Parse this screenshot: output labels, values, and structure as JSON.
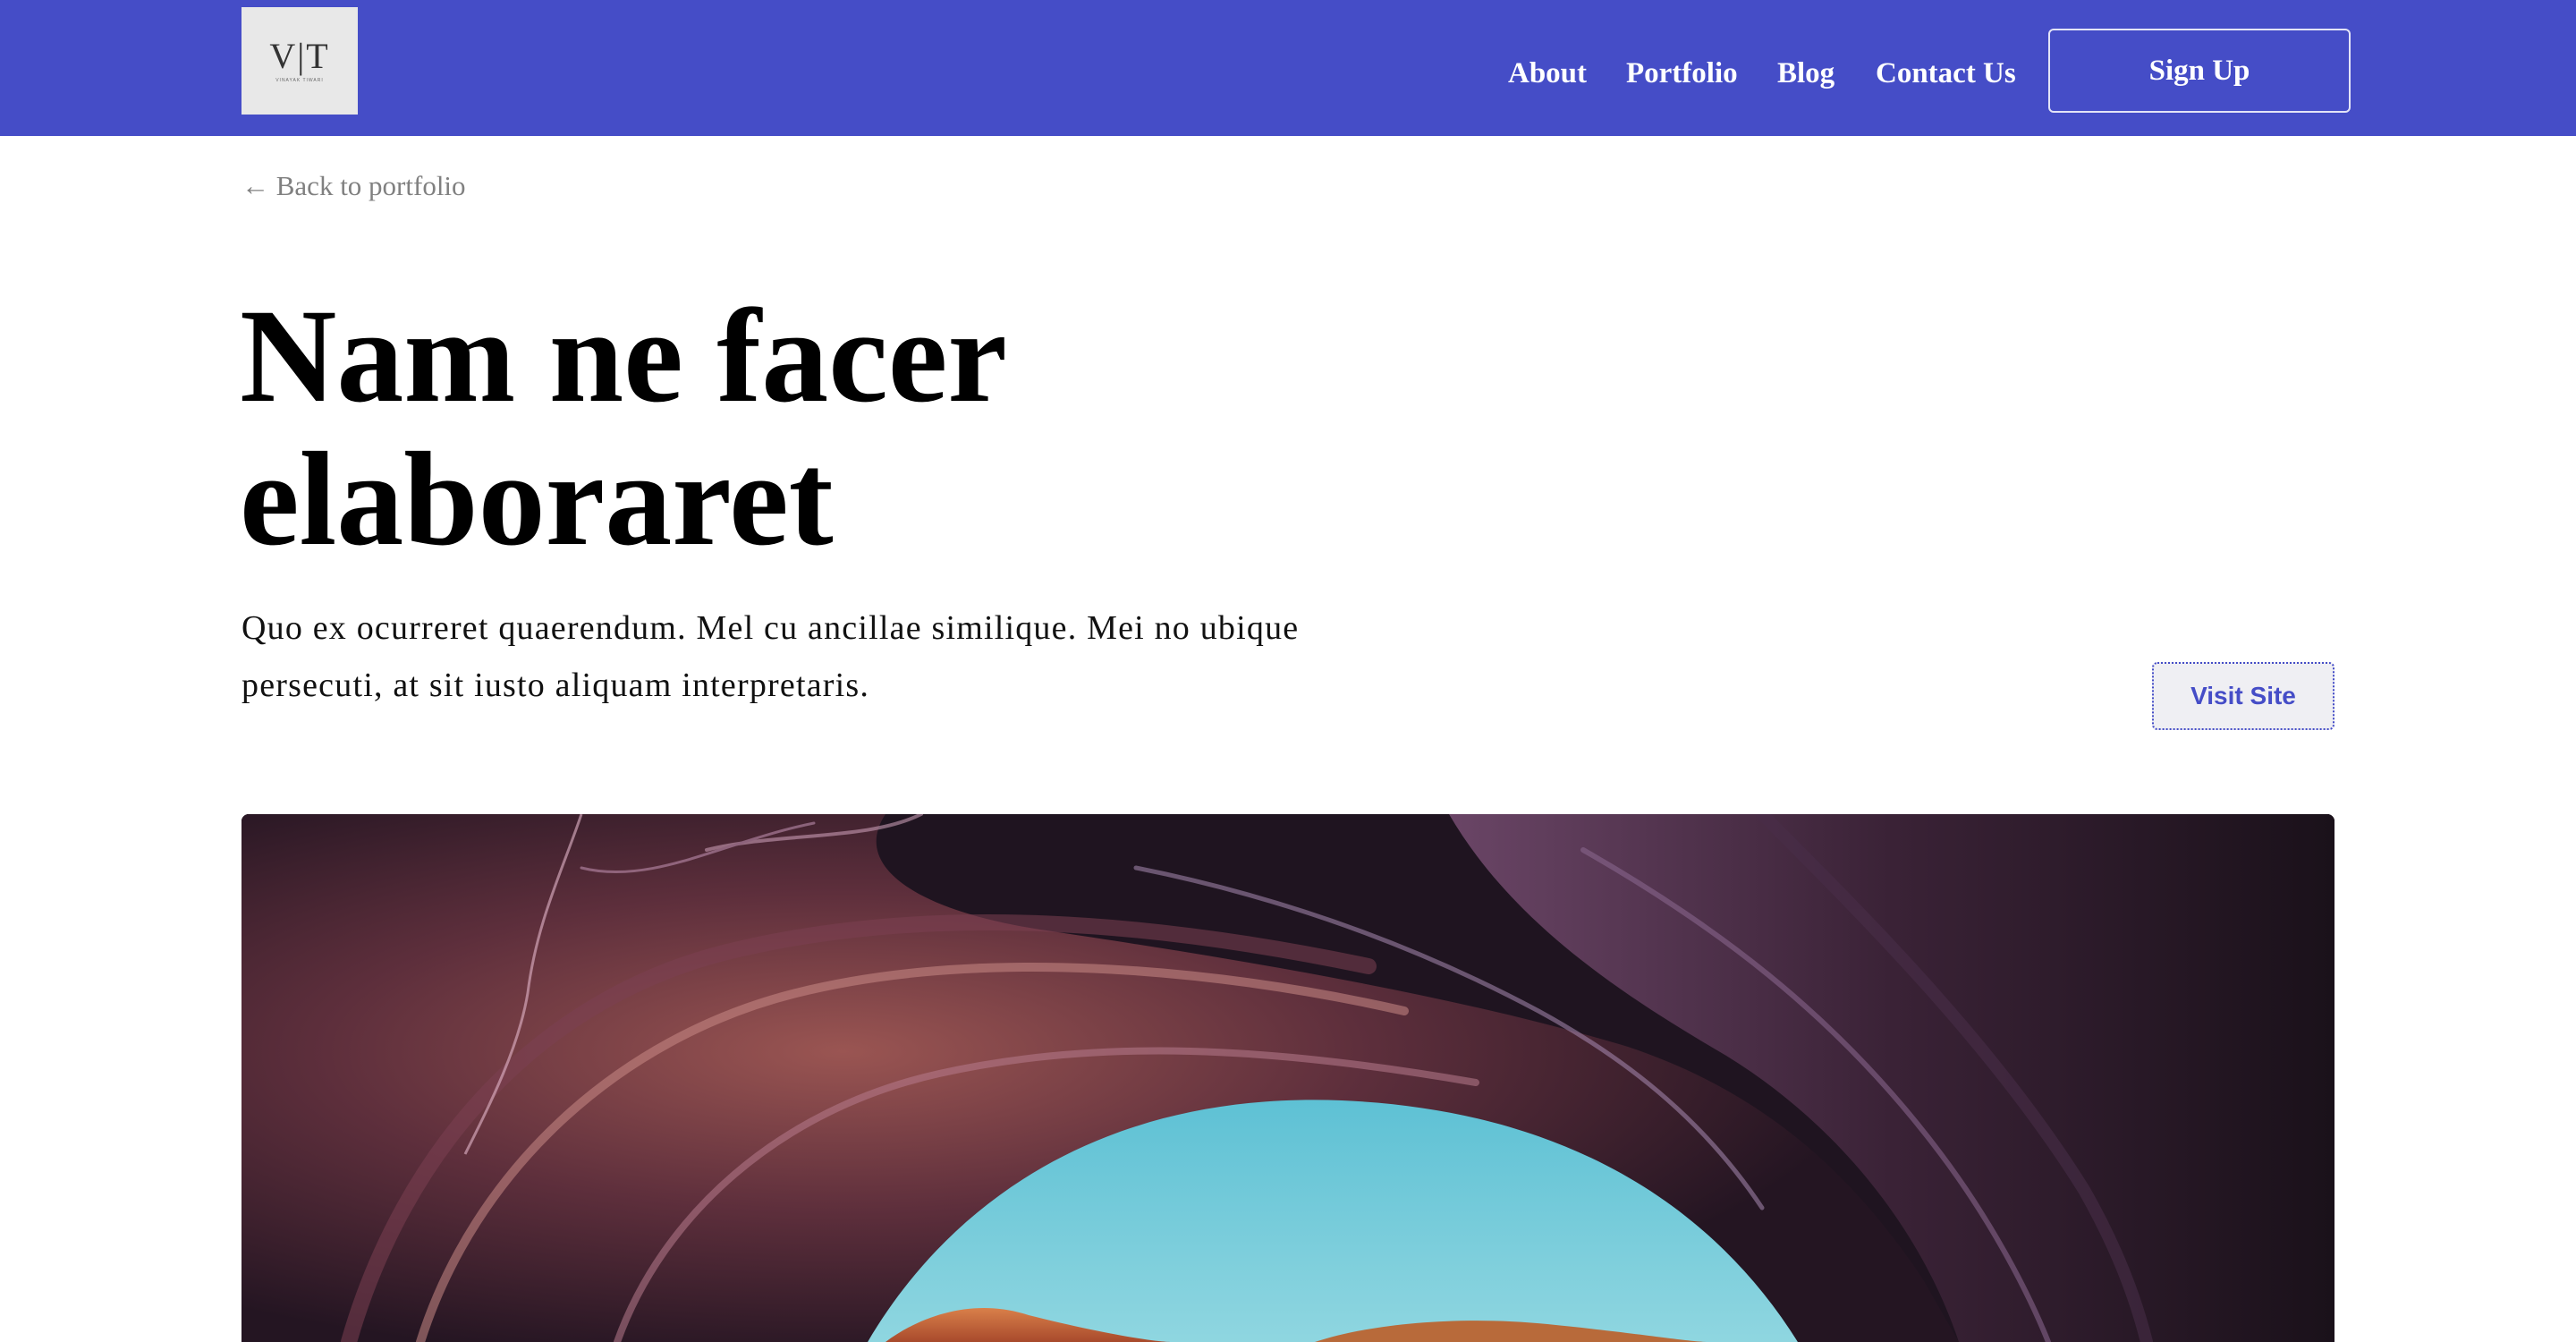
{
  "header": {
    "logo_text": "V|T",
    "logo_subtext": "VINAYAK TIWARI",
    "nav": [
      {
        "label": "About"
      },
      {
        "label": "Portfolio"
      },
      {
        "label": "Blog"
      },
      {
        "label": "Contact Us"
      }
    ],
    "signup_label": "Sign Up",
    "brand_color": "#454dc7"
  },
  "back_link": {
    "arrow": "←",
    "label": "Back to portfolio"
  },
  "project": {
    "title": "Nam ne facer elaboraret",
    "description": "Quo ex ocurreret quaerendum. Mel cu ancillae similique. Mei no ubique persecuti, at sit iusto aliquam interpretaris.",
    "visit_label": "Visit Site"
  },
  "hero": {
    "subject": "canyon-arch-photo"
  }
}
